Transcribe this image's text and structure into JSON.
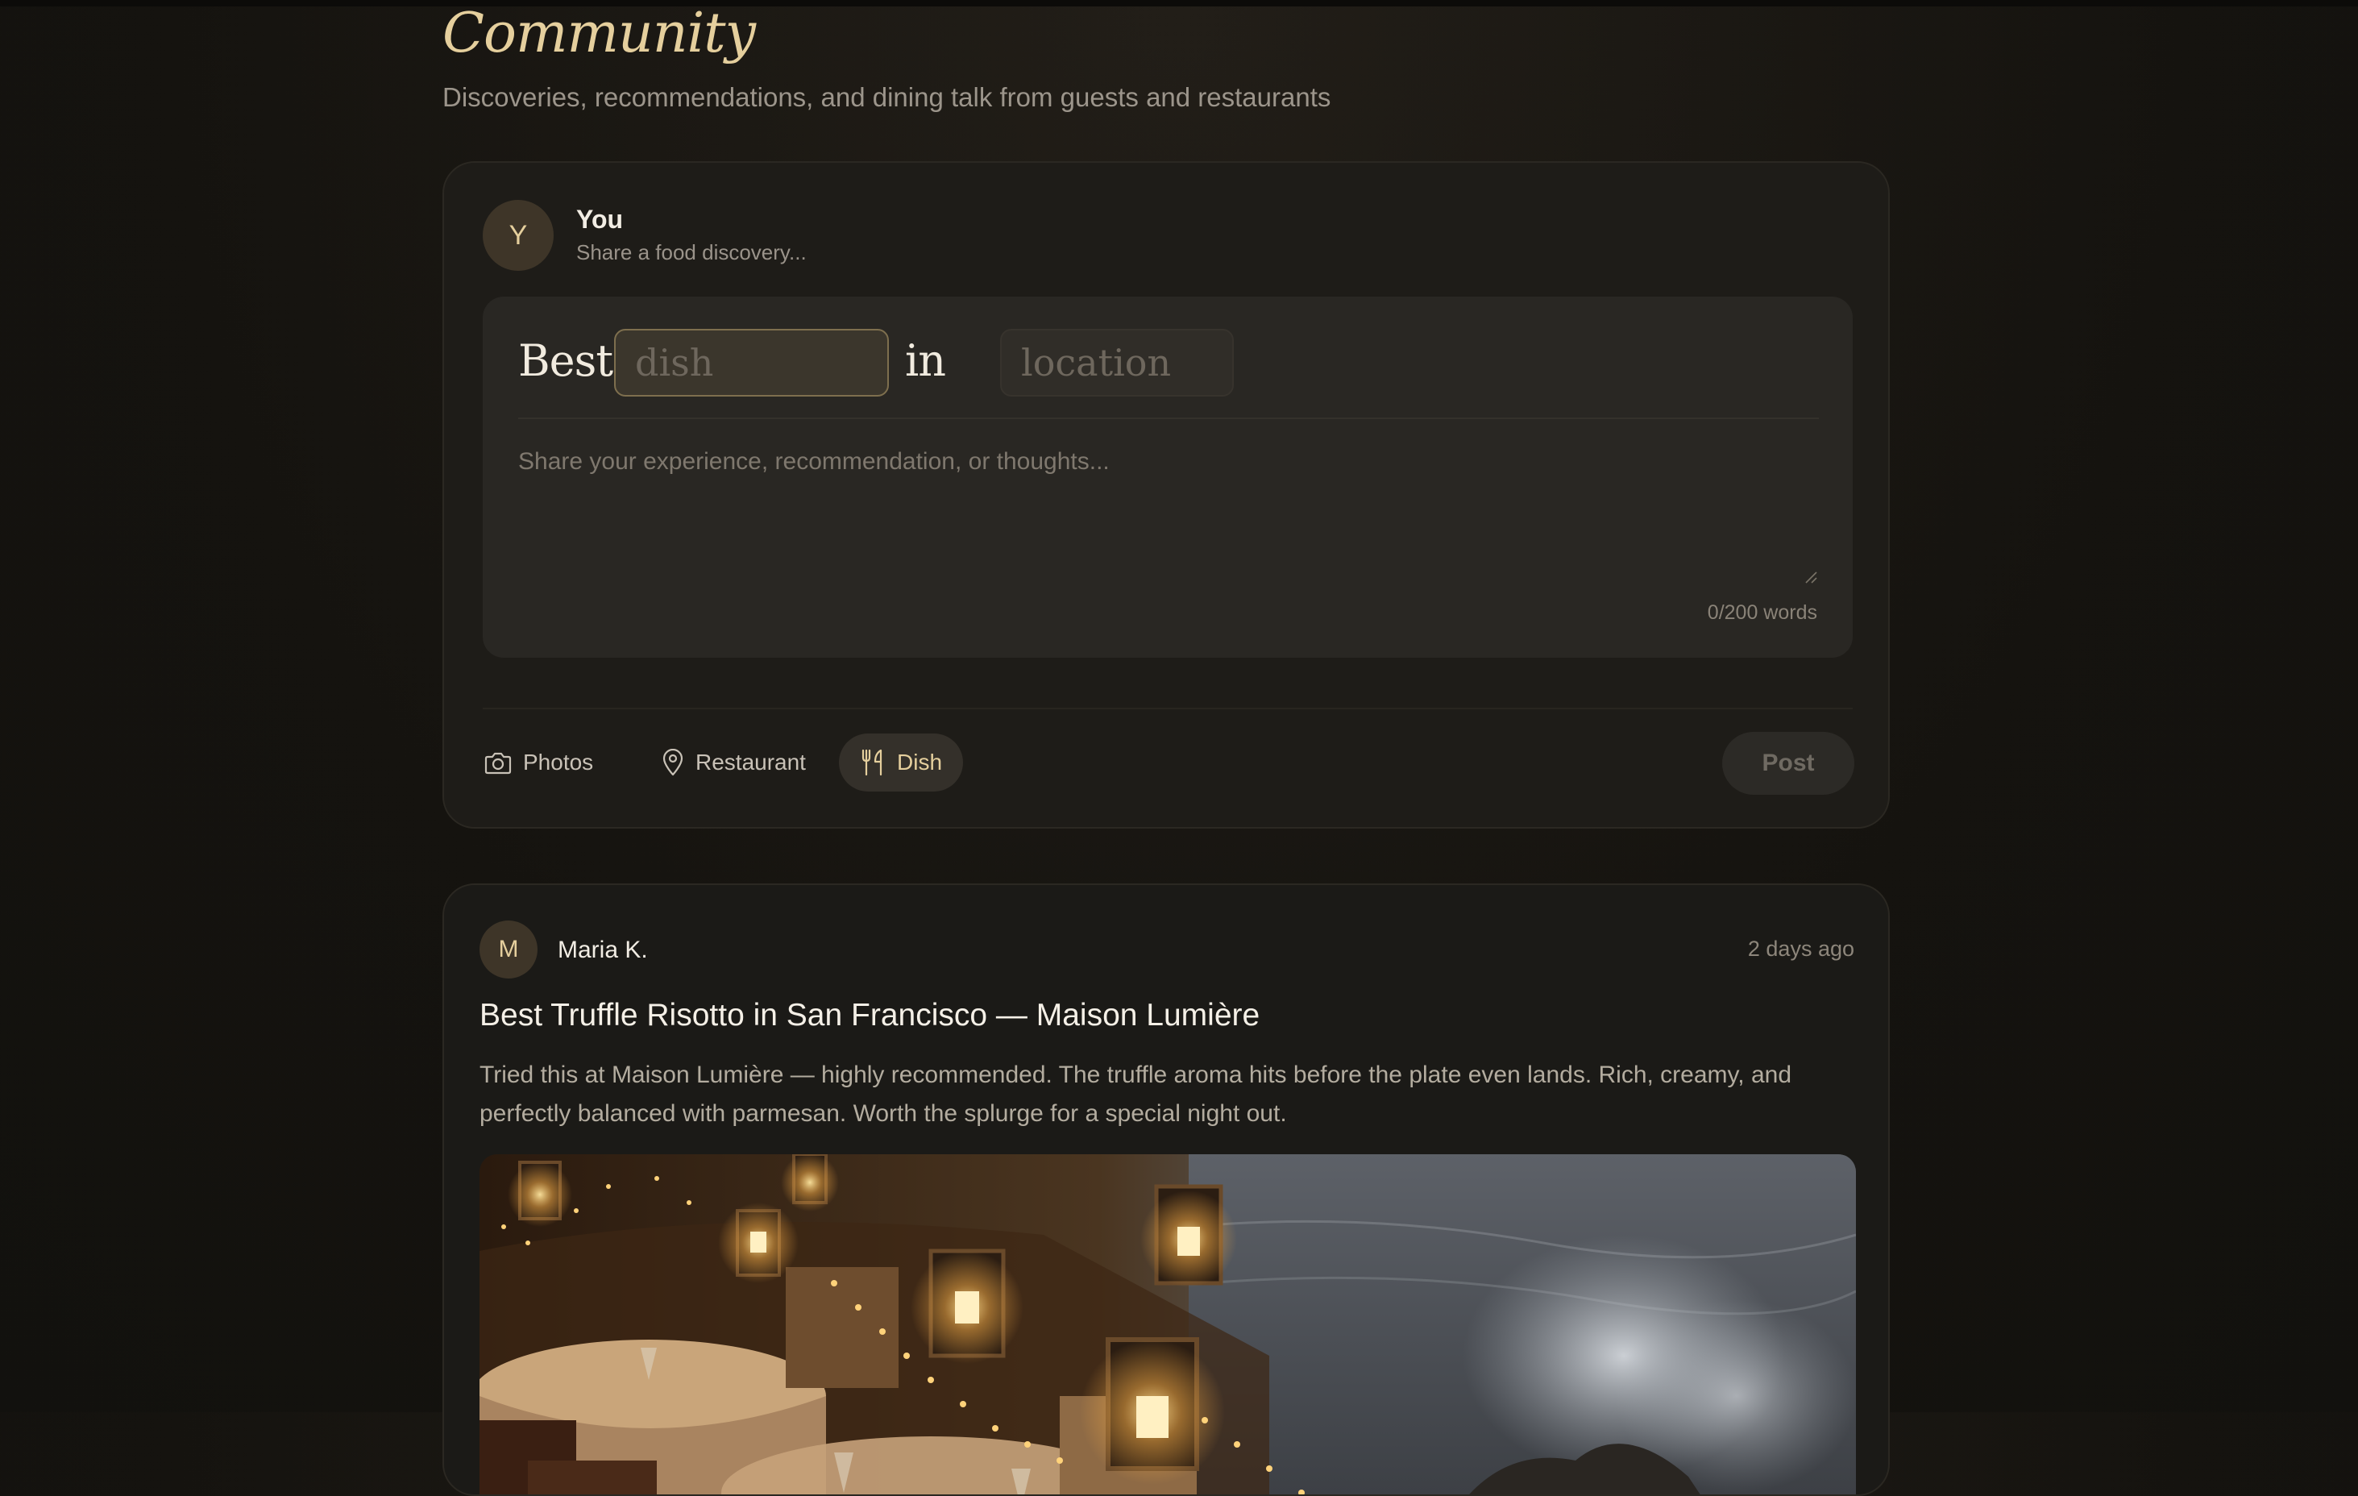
{
  "page": {
    "title": "Community",
    "subtitle": "Discoveries, recommendations, and dining talk from guests and restaurants"
  },
  "composer": {
    "avatar_initial": "Y",
    "user_name": "You",
    "hint": "Share a food discovery...",
    "best_word": "Best",
    "dish_placeholder": "dish",
    "in_word": "in",
    "location_placeholder": "location",
    "body_placeholder": "Share your experience, recommendation, or thoughts...",
    "word_count": "0/200 words",
    "tools": {
      "photos": "Photos",
      "restaurant": "Restaurant",
      "dish": "Dish"
    },
    "active_tool": "dish",
    "post_label": "Post"
  },
  "posts": [
    {
      "avatar_initial": "M",
      "author": "Maria K.",
      "time": "2 days ago",
      "title": "Best Truffle Risotto in San Francisco — Maison Lumière",
      "body": "Tried this at Maison Lumière — highly recommended. The truffle aroma hits before the plate even lands. Rich, creamy, and perfectly balanced with parmesan. Worth the splurge for a special night out.",
      "image": "candlelit-seaside-dining-photo"
    }
  ],
  "colors": {
    "accent_gold": "#e5cf9d",
    "background": "#15130f",
    "card": "#1e1c18"
  }
}
